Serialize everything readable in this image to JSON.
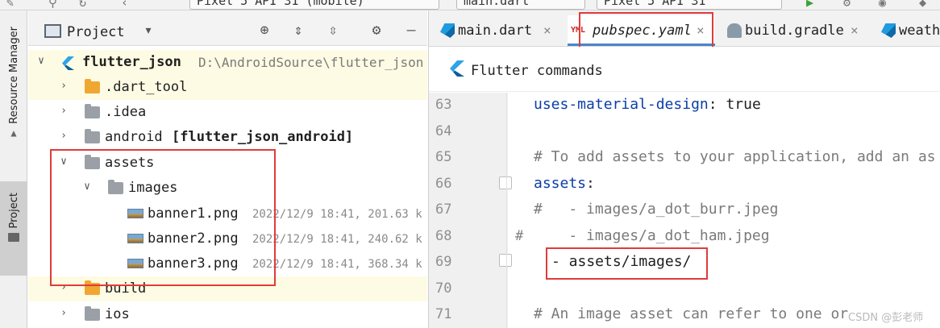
{
  "toolbar": {
    "device_selector": "Pixel 5 API 31 (mobile)",
    "file_selector": "main.dart",
    "device_selector_2": "Pixel 5 API 31"
  },
  "left_strip": {
    "resource_manager": "Resource Manager",
    "project": "Project"
  },
  "project_panel": {
    "title": "Project",
    "root": {
      "name": "flutter_json",
      "path": "D:\\AndroidSource\\flutter_json"
    },
    "items": [
      {
        "label": ".dart_tool"
      },
      {
        "label": ".idea"
      },
      {
        "label": "android",
        "module": "[flutter_json_android]"
      },
      {
        "label": "assets"
      },
      {
        "label": "images"
      },
      {
        "label": "banner1.png",
        "meta": "2022/12/9 18:41, 201.63 k"
      },
      {
        "label": "banner2.png",
        "meta": "2022/12/9 18:41, 240.62 k"
      },
      {
        "label": "banner3.png",
        "meta": "2022/12/9 18:41, 368.34 k"
      },
      {
        "label": "build"
      },
      {
        "label": "ios"
      }
    ]
  },
  "editor": {
    "tabs": [
      {
        "label": "main.dart"
      },
      {
        "label": "pubspec.yaml",
        "icon_text": "YML"
      },
      {
        "label": "build.gradle"
      },
      {
        "label": "weath"
      }
    ],
    "commands_bar": "Flutter commands",
    "lines": [
      {
        "n": "63",
        "key": "uses-material-design",
        "sep": ": ",
        "val": "true"
      },
      {
        "n": "64",
        "text": ""
      },
      {
        "n": "65",
        "comment": "# To add assets to your application, add an as"
      },
      {
        "n": "66",
        "key": "assets",
        "sep": ":"
      },
      {
        "n": "67",
        "comment": "#   - images/a_dot_burr.jpeg"
      },
      {
        "n": "68",
        "gutter_hash": "#",
        "comment": "    - images/a_dot_ham.jpeg"
      },
      {
        "n": "69",
        "text": "- assets/images/"
      },
      {
        "n": "70",
        "text": ""
      },
      {
        "n": "71",
        "comment": "# An image asset can refer to one or"
      }
    ],
    "watermark": "CSDN @彭老师"
  },
  "colors": {
    "highlight_box": "#e03b3b",
    "yaml_key": "#0b3ea8",
    "comment": "#7a7a7a",
    "active_tab_underline": "#4a86c8"
  }
}
